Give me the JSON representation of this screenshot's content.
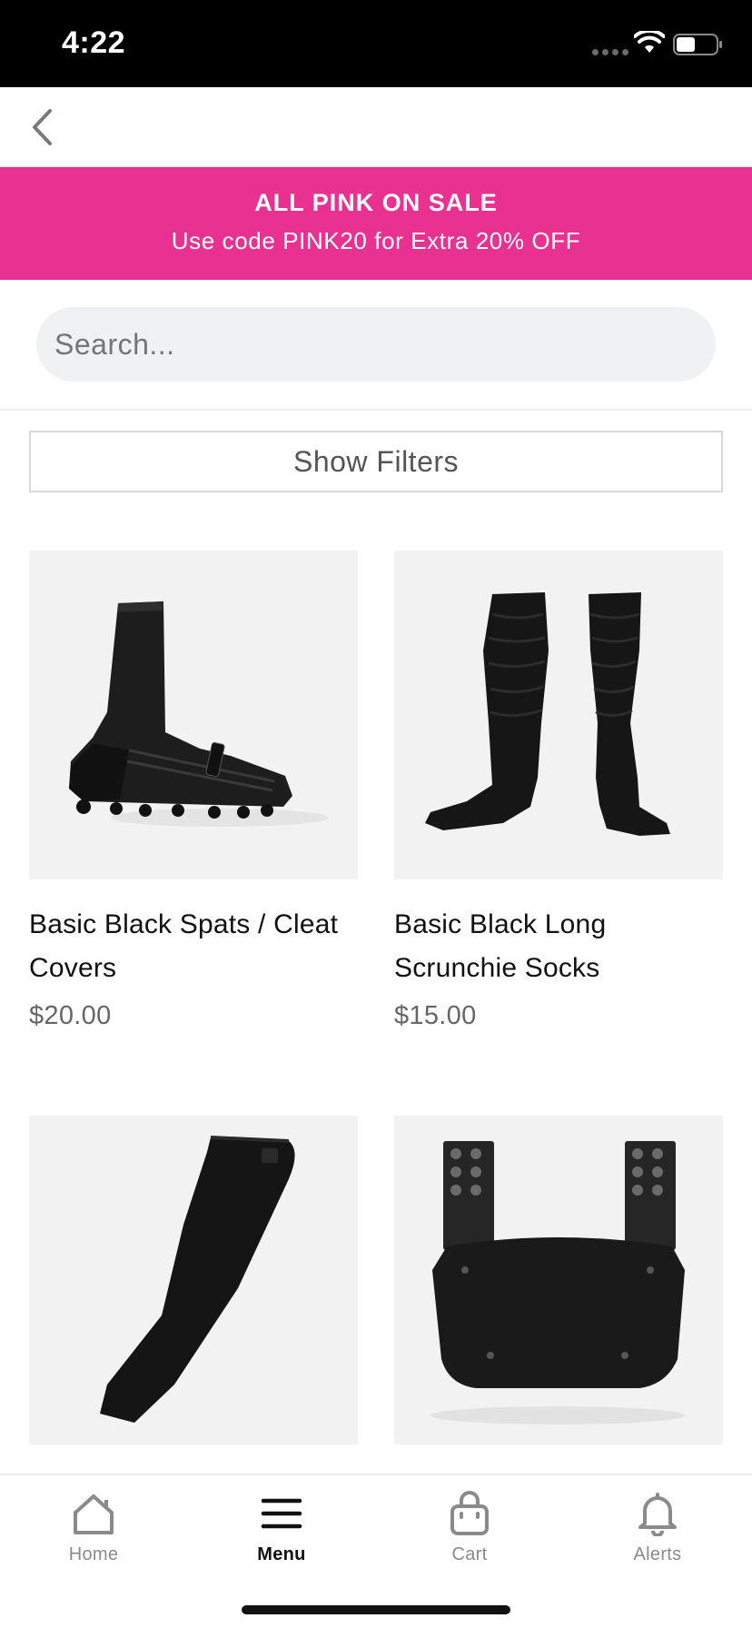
{
  "status_bar": {
    "time": "4:22"
  },
  "promo": {
    "title": "ALL PINK ON SALE",
    "subtitle": "Use code PINK20 for Extra 20% OFF",
    "background": "#e83190"
  },
  "search": {
    "placeholder": "Search..."
  },
  "filters": {
    "label": "Show Filters"
  },
  "products": [
    {
      "name": "Basic Black Spats / Cleat Covers",
      "price": "$20.00",
      "image_icon": "cleat-cover-image"
    },
    {
      "name": "Basic Black Long Scrunchie Socks",
      "price": "$15.00",
      "image_icon": "scrunchie-socks-image"
    },
    {
      "name": "",
      "price": "",
      "image_icon": "arm-sleeve-image"
    },
    {
      "name": "",
      "price": "",
      "image_icon": "back-plate-image"
    }
  ],
  "tab_bar": {
    "items": [
      {
        "label": "Home",
        "icon": "home-icon",
        "active": false
      },
      {
        "label": "Menu",
        "icon": "menu-icon",
        "active": true
      },
      {
        "label": "Cart",
        "icon": "bag-icon",
        "active": false
      },
      {
        "label": "Alerts",
        "icon": "bell-icon",
        "active": false
      }
    ]
  }
}
